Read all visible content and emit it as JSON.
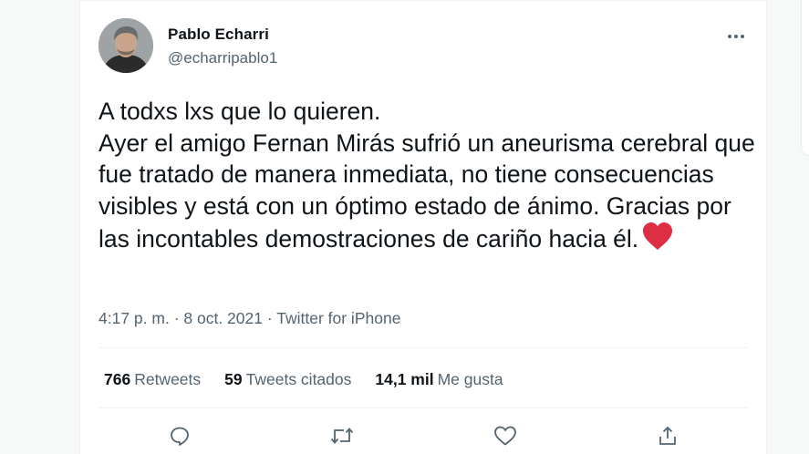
{
  "author": {
    "name": "Pablo Echarri",
    "handle": "@echarripablo1"
  },
  "tweet": {
    "text": "A todxs lxs que lo quieren.\nAyer el amigo Fernan Mirás sufrió un aneurisma cerebral que fue tratado de manera inmediata, no tiene consecuencias visibles y está con un óptimo estado de ánimo. Gracias por las incontables demostraciones de cariño hacia él.",
    "emoji": "red-heart"
  },
  "meta": {
    "time": "4:17 p. m.",
    "separator1": " · ",
    "date": "8 oct. 2021",
    "separator2": " · ",
    "source": "Twitter for iPhone"
  },
  "stats": {
    "retweets_count": "766",
    "retweets_label": "Retweets",
    "quotes_count": "59",
    "quotes_label": "Tweets citados",
    "likes_count": "14,1 mil",
    "likes_label": "Me gusta"
  },
  "icons": {
    "more": "more-horizontal-icon",
    "reply": "reply-icon",
    "retweet": "retweet-icon",
    "like": "like-icon",
    "share": "share-icon"
  },
  "colors": {
    "text": "#0f1419",
    "secondary": "#536471",
    "heart": "#e0245e"
  }
}
